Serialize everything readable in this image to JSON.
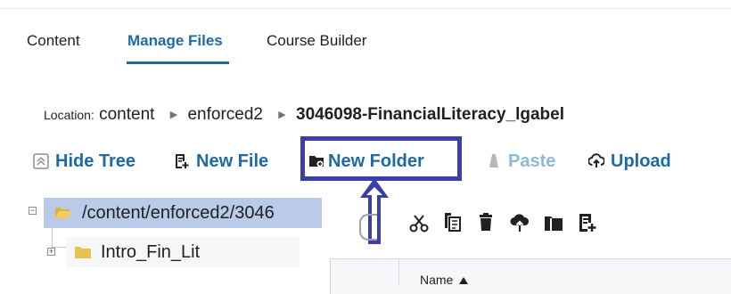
{
  "tabs": [
    {
      "label": "Content",
      "active": false
    },
    {
      "label": "Manage Files",
      "active": true
    },
    {
      "label": "Course Builder",
      "active": false
    }
  ],
  "location": {
    "label": "Location:",
    "path": [
      "content",
      "enforced2",
      "3046098-FinancialLiteracy_lgabel"
    ]
  },
  "toolbar": {
    "hide_tree": "Hide Tree",
    "new_file": "New File",
    "new_folder": "New Folder",
    "paste": "Paste",
    "upload": "Upload"
  },
  "tree": {
    "root": "/content/enforced2/3046",
    "children": [
      "Intro_Fin_Lit"
    ]
  },
  "file_actions": [
    "cut-icon",
    "copy-icon",
    "delete-icon",
    "upload-icon",
    "folder-icon",
    "new-file-icon"
  ],
  "table": {
    "columns": [
      {
        "label": "Name",
        "sort": "ascending"
      }
    ]
  },
  "colors": {
    "accent": "#1e6aa6",
    "highlight_box": "#3b3fa8",
    "selected_row": "#b9cbe8"
  }
}
